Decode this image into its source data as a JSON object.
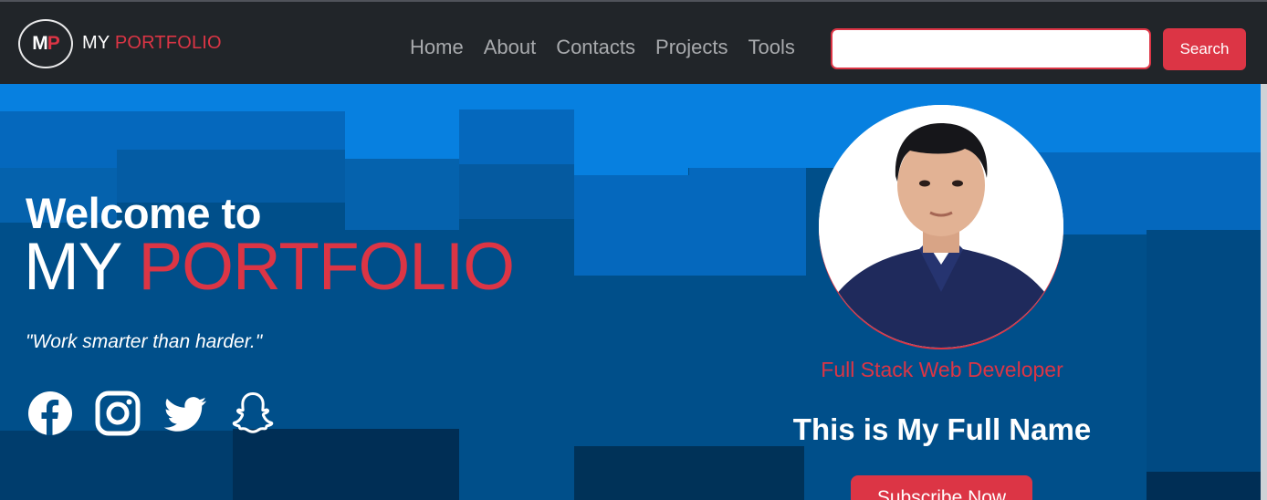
{
  "brand": {
    "logo_m": "M",
    "logo_p": "P",
    "name_my": "MY",
    "name_portfolio": "PORTFOLIO"
  },
  "nav": {
    "links": [
      "Home",
      "About",
      "Contacts",
      "Projects",
      "Tools"
    ]
  },
  "search": {
    "value": "",
    "placeholder": "",
    "button_label": "Search"
  },
  "hero": {
    "welcome": "Welcome to",
    "title_my": "MY",
    "title_portfolio": "PORTFOLIO",
    "tagline": "\"Work smarter than harder.\"",
    "socials": [
      "facebook-icon",
      "instagram-icon",
      "twitter-icon",
      "snapchat-icon"
    ]
  },
  "profile": {
    "role": "Full Stack Web Developer",
    "name": "This is My Full Name",
    "cta_label": "Subscribe Now"
  },
  "colors": {
    "navbar": "#212529",
    "accent": "#dc3545",
    "hero_blue": "#004f8a",
    "text_muted": "#a8aaad"
  }
}
